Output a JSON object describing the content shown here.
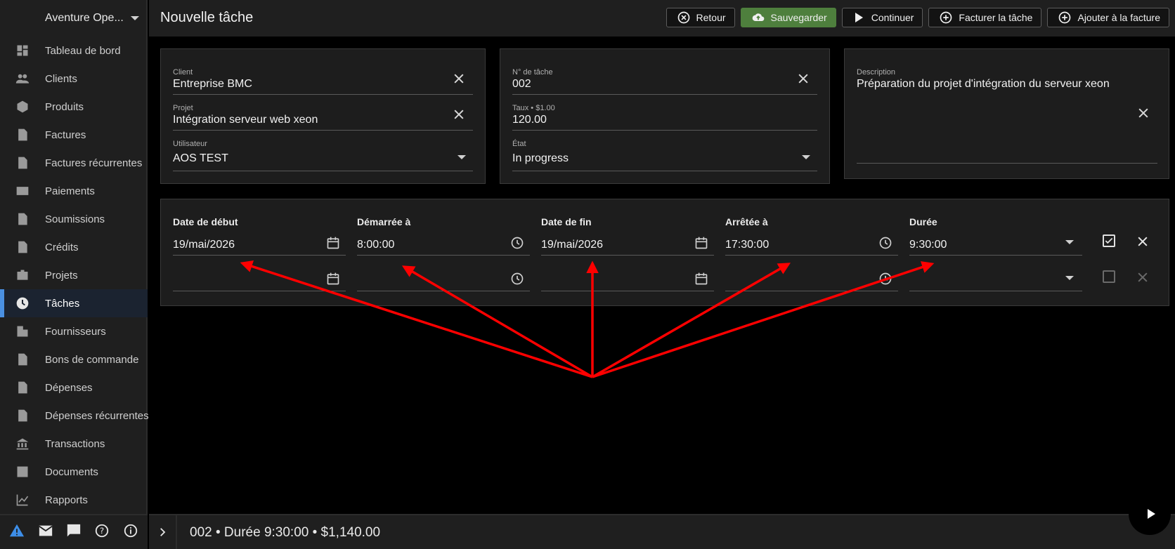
{
  "sidebar": {
    "company": "Aventure Ope...",
    "items": [
      {
        "label": "Tableau de bord",
        "icon": "dashboard-icon"
      },
      {
        "label": "Clients",
        "icon": "people-icon"
      },
      {
        "label": "Produits",
        "icon": "cube-icon"
      },
      {
        "label": "Factures",
        "icon": "invoice-icon"
      },
      {
        "label": "Factures récurrentes",
        "icon": "recurring-invoice-icon"
      },
      {
        "label": "Paiements",
        "icon": "credit-card-icon"
      },
      {
        "label": "Soumissions",
        "icon": "quote-icon"
      },
      {
        "label": "Crédits",
        "icon": "credit-icon"
      },
      {
        "label": "Projets",
        "icon": "briefcase-icon"
      },
      {
        "label": "Tâches",
        "icon": "clock-icon",
        "active": true
      },
      {
        "label": "Fournisseurs",
        "icon": "building-icon"
      },
      {
        "label": "Bons de commande",
        "icon": "document-icon"
      },
      {
        "label": "Dépenses",
        "icon": "expense-icon"
      },
      {
        "label": "Dépenses récurrentes",
        "icon": "recurring-expense-icon"
      },
      {
        "label": "Transactions",
        "icon": "bank-icon"
      },
      {
        "label": "Documents",
        "icon": "image-icon"
      },
      {
        "label": "Rapports",
        "icon": "chart-line-icon"
      }
    ],
    "footer_icons": [
      "warning-icon",
      "mail-icon",
      "chat-icon",
      "help-icon",
      "info-icon"
    ]
  },
  "header": {
    "title": "Nouvelle tâche",
    "buttons": {
      "back": "Retour",
      "save": "Sauvegarder",
      "resume": "Continuer",
      "invoice_task": "Facturer la tâche",
      "add_to_invoice": "Ajouter à la facture"
    }
  },
  "details": {
    "client_label": "Client",
    "client_value": "Entreprise BMC",
    "project_label": "Projet",
    "project_value": "Intégration serveur web xeon",
    "user_label": "Utilisateur",
    "user_value": "AOS TEST"
  },
  "task": {
    "number_label": "N° de tâche",
    "number_value": "002",
    "rate_label": "Taux • $1.00",
    "rate_value": "120.00",
    "status_label": "État",
    "status_value": "In progress"
  },
  "description": {
    "label": "Description",
    "value": "Préparation du projet d'intégration du serveur xeon"
  },
  "time_log": {
    "headers": {
      "start_date": "Date de début",
      "started_at": "Démarrée à",
      "end_date": "Date de fin",
      "stopped_at": "Arrêtée à",
      "duration": "Durée"
    },
    "rows": [
      {
        "start_date": "19/mai/2026",
        "started_at": "8:00:00",
        "end_date": "19/mai/2026",
        "stopped_at": "17:30:00",
        "duration": "9:30:00",
        "billable": true
      },
      {
        "start_date": "",
        "started_at": "",
        "end_date": "",
        "stopped_at": "",
        "duration": "",
        "billable": false
      }
    ]
  },
  "footer": {
    "summary": "002 • Durée 9:30:00 • $1,140.00"
  },
  "annotation": {
    "arrow_color": "#ff0000"
  }
}
